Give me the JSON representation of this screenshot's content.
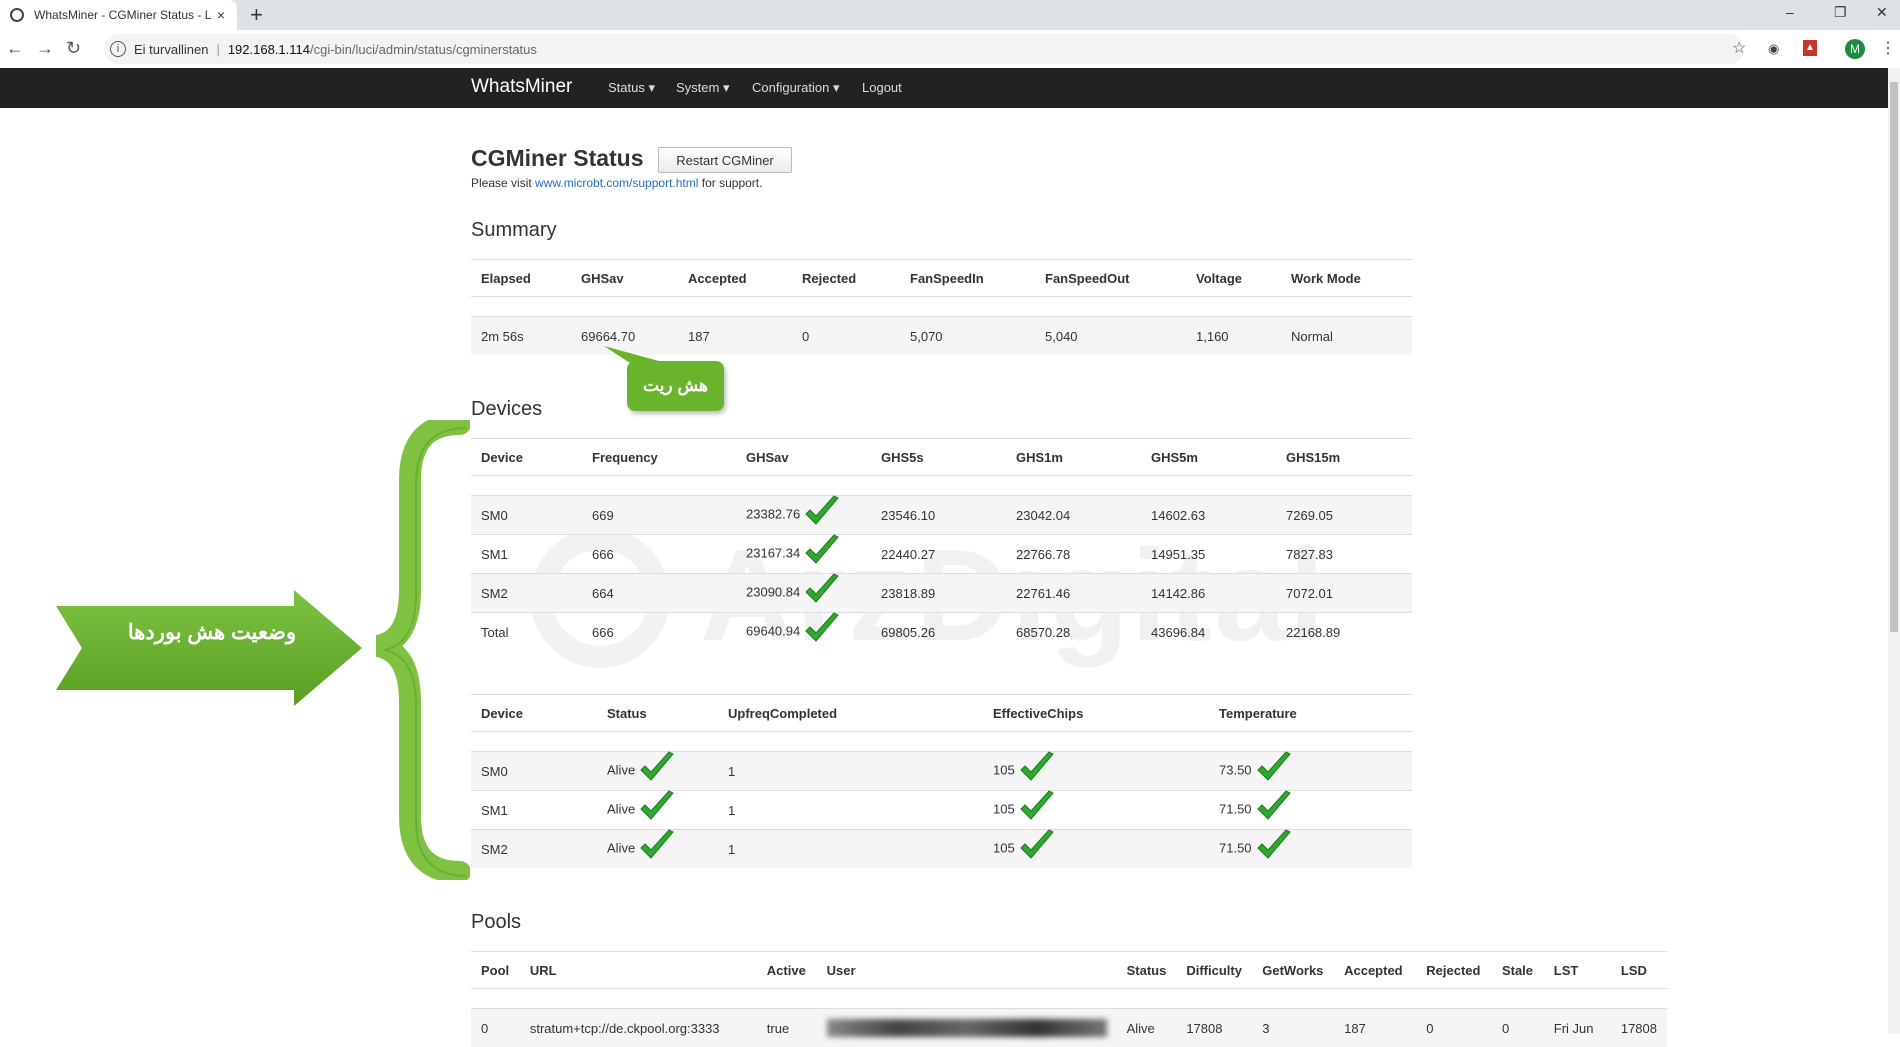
{
  "browser": {
    "tab_title": "WhatsMiner - CGMiner Status - L",
    "close": "×",
    "new_tab": "+",
    "security": "Ei turvallinen",
    "url_host": "192.168.1.114",
    "url_path": "/cgi-bin/luci/admin/status/cgminerstatus",
    "profile_initial": "M"
  },
  "navbar": {
    "brand": "WhatsMiner",
    "items": [
      "Status",
      "System",
      "Configuration",
      "Logout"
    ]
  },
  "page": {
    "title": "CGMiner Status",
    "restart_button": "Restart CGMiner",
    "support_prefix": "Please visit ",
    "support_link": "www.microbt.com/support.html",
    "support_suffix": " for support."
  },
  "summary": {
    "title": "Summary",
    "headers": [
      "Elapsed",
      "GHSav",
      "Accepted",
      "Rejected",
      "FanSpeedIn",
      "FanSpeedOut",
      "Voltage",
      "Work Mode"
    ],
    "row": [
      "2m 56s",
      "69664.70",
      "187",
      "0",
      "5,070",
      "5,040",
      "1,160",
      "Normal"
    ]
  },
  "devices": {
    "title": "Devices",
    "headers": [
      "Device",
      "Frequency",
      "GHSav",
      "GHS5s",
      "GHS1m",
      "GHS5m",
      "GHS15m"
    ],
    "rows": [
      [
        "SM0",
        "669",
        "23382.76",
        "23546.10",
        "23042.04",
        "14602.63",
        "7269.05"
      ],
      [
        "SM1",
        "666",
        "23167.34",
        "22440.27",
        "22766.78",
        "14951.35",
        "7827.83"
      ],
      [
        "SM2",
        "664",
        "23090.84",
        "23818.89",
        "22761.46",
        "14142.86",
        "7072.01"
      ],
      [
        "Total",
        "666",
        "69640.94",
        "69805.26",
        "68570.28",
        "43696.84",
        "22168.89"
      ]
    ],
    "status_headers": [
      "Device",
      "Status",
      "UpfreqCompleted",
      "EffectiveChips",
      "Temperature"
    ],
    "status_rows": [
      [
        "SM0",
        "Alive",
        "1",
        "105",
        "73.50"
      ],
      [
        "SM1",
        "Alive",
        "1",
        "105",
        "71.50"
      ],
      [
        "SM2",
        "Alive",
        "1",
        "105",
        "71.50"
      ]
    ]
  },
  "pools": {
    "title": "Pools",
    "headers": [
      "Pool",
      "URL",
      "Active",
      "User",
      "Status",
      "Difficulty",
      "GetWorks",
      "Accepted",
      "Rejected",
      "Stale",
      "LST",
      "LSD"
    ],
    "row": [
      "0",
      "stratum+tcp://de.ckpool.org:3333",
      "true",
      "",
      "Alive",
      "17808",
      "3",
      "187",
      "0",
      "0",
      "Fri Jun",
      "17808"
    ]
  },
  "annotations": {
    "hashrate_label": "هش ریت",
    "boards_label": "وضعیت هش بوردها",
    "watermark": "ArzDigital"
  },
  "colors": {
    "annotation_green": "#6ab32d",
    "check_green": "#2ea82e",
    "navbar": "#222222",
    "link": "#2a6bbf"
  }
}
